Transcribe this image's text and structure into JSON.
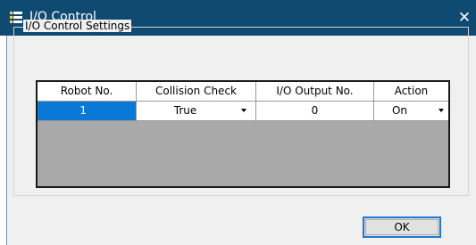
{
  "window": {
    "title": "I/O Control",
    "close_glyph": "✕",
    "icon": "app-icon"
  },
  "group": {
    "label": "I/O Control Settings"
  },
  "grid": {
    "columns": [
      "Robot No.",
      "Collision Check",
      "I/O Output No.",
      "Action"
    ],
    "rows": [
      {
        "robot_no": "1",
        "collision_check": "True",
        "io_output_no": "0",
        "action": "On"
      }
    ]
  },
  "buttons": {
    "ok": "OK"
  },
  "colors": {
    "titlebar": "#0f4a73",
    "selection": "#0a78d7",
    "grid_empty": "#a9a9a9",
    "dialog": "#f0f0f0",
    "ok_border": "#1f78d1"
  }
}
